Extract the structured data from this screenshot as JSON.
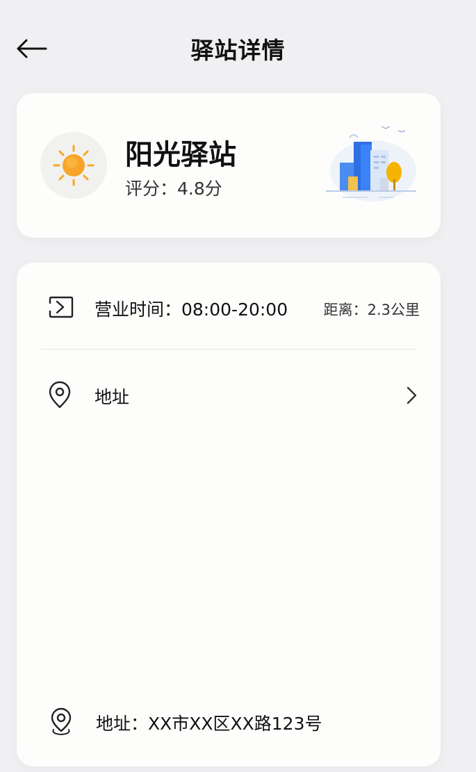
{
  "header": {
    "title": "驿站详情",
    "back_icon": "arrow-left-icon"
  },
  "station": {
    "name": "阳光驿站",
    "rating_text": "评分：4.8分",
    "avatar_icon": "sun-icon",
    "illustration": "city-building-illustration",
    "colors": {
      "sun": "#f9a825",
      "building": "#3b82f6",
      "tree": "#f5b400"
    }
  },
  "details": {
    "hours_icon": "chevron-box-icon",
    "hours_text": "营业时间：08:00-20:00",
    "distance_text": "距离：2.3公里",
    "address_icon": "location-pin-icon",
    "address_label": "地址",
    "address_chevron_icon": "chevron-right-icon",
    "full_address_icon": "location-pin-icon",
    "full_address_text": "地址：XX市XX区XX路123号"
  }
}
